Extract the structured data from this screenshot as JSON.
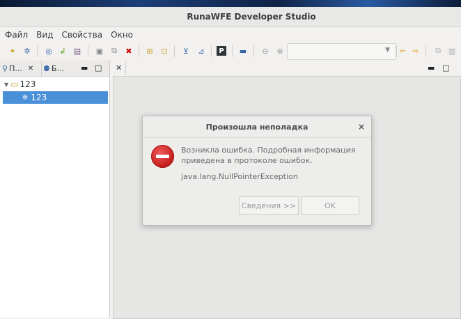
{
  "window": {
    "title": "RunaWFE Developer Studio"
  },
  "menu": [
    "Файл",
    "Вид",
    "Свойства",
    "Окно"
  ],
  "left_panel": {
    "tabs": [
      {
        "label": "П..."
      },
      {
        "label": "Б..."
      }
    ],
    "tree": [
      {
        "label": "123",
        "level": 0,
        "expanded": true
      },
      {
        "label": "123",
        "level": 1,
        "selected": true
      }
    ]
  },
  "dialog": {
    "title": "Произошла неполадка",
    "close": "×",
    "message": "Возникла ошибка. Подробная информация приведена в протоколе ошибок.",
    "exception": "java.lang.NullPointerException",
    "details_button": "Сведения >>",
    "ok_button": "OK"
  },
  "icons": {
    "minimize": "▬",
    "maximize": "□",
    "close_tab": "✕",
    "delete": "✖",
    "combo_arrow": "▼"
  },
  "colors": {
    "selection": "#4a90d9",
    "error": "#c41a1a"
  }
}
